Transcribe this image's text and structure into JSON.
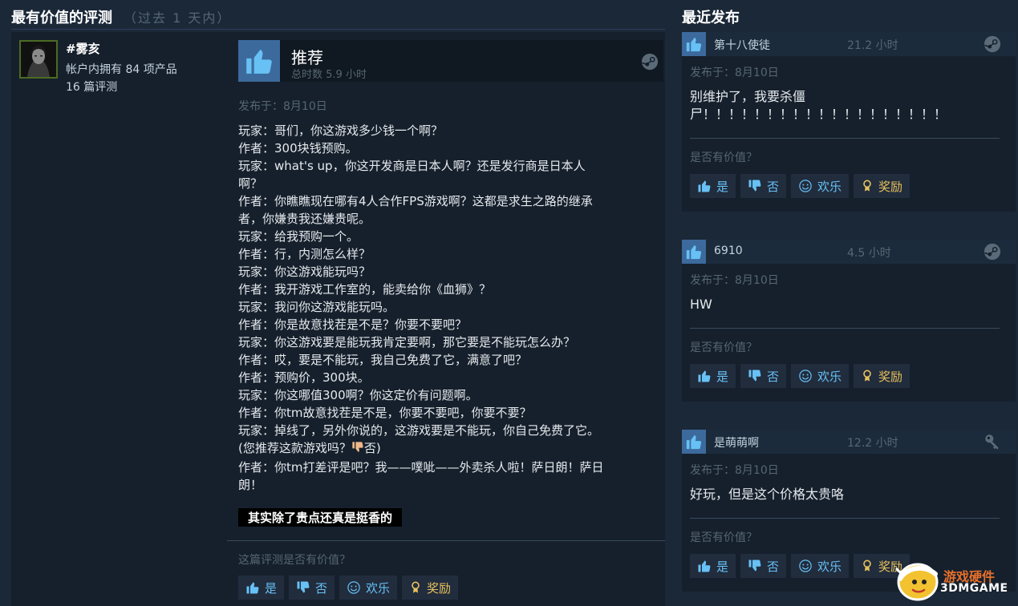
{
  "left_section": {
    "title": "最有价值的评测",
    "subtitle": "（过去 1 天内）"
  },
  "right_section": {
    "title": "最近发布"
  },
  "main_review": {
    "author": {
      "name": "#雾亥",
      "products": "帐户内拥有 84 项产品",
      "reviews": "16 篇评测"
    },
    "recommendation": "推荐",
    "hours": "总时数 5.9 小时",
    "posted": "发布于：8月10日",
    "lines": [
      "玩家：哥们，你这游戏多少钱一个啊？",
      "作者：300块钱预购。",
      "玩家：what's up，你这开发商是日本人啊？还是发行商是日本人",
      "啊？",
      "作者：你瞧瞧现在哪有4人合作FPS游戏啊？这都是求生之路的继承",
      "者，你嫌贵我还嫌贵呢。",
      "玩家：给我预购一个。",
      "作者：行，内测怎么样？",
      "玩家：你这游戏能玩吗？",
      "作者：我开游戏工作室的，能卖给你《血狮》？",
      "玩家：我问你这游戏能玩吗。",
      "作者：你是故意找茬是不是？你要不要吧？",
      "玩家：你这游戏要是能玩我肯定要啊，那它要是不能玩怎么办？",
      "作者：哎，要是不能玩，我自己免费了它，满意了吧？",
      "作者：预购价，300块。",
      "玩家：你这哪值300啊？你这定价有问题啊。",
      "作者：你tm故意找茬是不是，你要不要吧，你要不要？",
      "玩家：掉线了，另外你说的，这游戏要是不能玩，你自己免费了它。"
    ],
    "inline_prefix": "(您推荐这款游戏吗？",
    "inline_suffix": "否)",
    "closing_lines": [
      "作者：你tm打差评是吧？我——噗呲——外卖杀人啦！萨日朗！萨日",
      "朗！"
    ],
    "highlight": "其实除了贵点还真是挺香的",
    "helpful_question": "这篇评测是否有价值？",
    "buttons": {
      "yes": "是",
      "no": "否",
      "funny": "欢乐",
      "award": "奖励"
    }
  },
  "recent_reviews": [
    {
      "name": "第十八使徒",
      "hours": "21.2 小时",
      "platform_icon": "steam-icon",
      "posted": "发布于：8月10日",
      "text_lines": [
        "别维护了，我要杀僵",
        "尸！！！！！！！！！！！！！！！！！！！"
      ],
      "question": "是否有价值？",
      "buttons": {
        "yes": "是",
        "no": "否",
        "funny": "欢乐",
        "award": "奖励"
      }
    },
    {
      "name": "6910",
      "hours": "4.5 小时",
      "platform_icon": "steam-icon",
      "posted": "发布于：8月10日",
      "text_lines": [
        "HW"
      ],
      "question": "是否有价值？",
      "buttons": {
        "yes": "是",
        "no": "否",
        "funny": "欢乐",
        "award": "奖励"
      }
    },
    {
      "name": "是萌萌啊",
      "hours": "12.2 小时",
      "platform_icon": "key-icon",
      "posted": "发布于：8月10日",
      "text_lines": [
        "好玩，但是这个价格太贵咯"
      ],
      "question": "是否有价值？",
      "buttons": {
        "yes": "是",
        "no": "否",
        "funny": "欢乐",
        "award": "奖励"
      }
    }
  ],
  "watermark": {
    "cn": "游戏硬件",
    "en": "3DMGAME"
  },
  "colors": {
    "background": "#1b2838",
    "panel": "#16202d",
    "thumb_blue": "#3c6a9c",
    "link_blue": "#67c1f5",
    "award_gold": "#e6c15c"
  }
}
